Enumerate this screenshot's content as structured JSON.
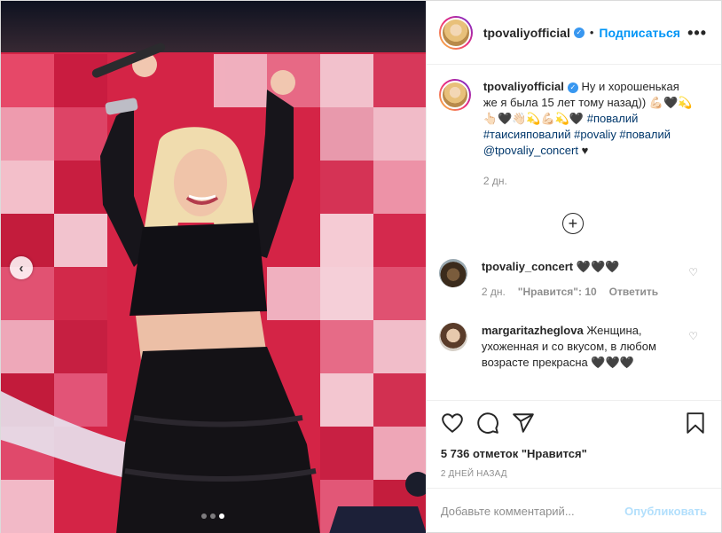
{
  "post": {
    "username": "tpovaliyofficial",
    "follow_separator": "•",
    "follow_label": "Подписаться",
    "more_label": "•••",
    "carousel": {
      "slides": 3,
      "active_slide": 3
    }
  },
  "caption": {
    "username": "tpovaliyofficial",
    "text": "Ну и хорошенькая же я была 15 лет тому назад)) 💪🏻🖤💫👆🏻🖤👋🏻💫💪🏻💫🖤",
    "hashtags": "#повалий #таисияповалий #povaliy #повалий",
    "mention": "@tpovaliy_concert",
    "tail": "♥",
    "time": "2 дн."
  },
  "comments": [
    {
      "username": "tpovaliy_concert",
      "text": "🖤🖤🖤",
      "time": "2 дн.",
      "likes": "\"Нравится\": 10",
      "reply": "Ответить"
    },
    {
      "username": "margaritazheglova",
      "text": "Женщина, ухоженная и со вкусом, в любом возрасте прекрасна 🖤🖤🖤"
    }
  ],
  "stats": {
    "likes": "5 736 отметок \"Нравится\"",
    "date": "2 ДНЕЙ НАЗАД"
  },
  "add_comment": {
    "placeholder": "Добавьте комментарий...",
    "publish": "Опубликовать"
  },
  "colors": {
    "accent": "#0095f6",
    "publish_disabled": "#b2dffc",
    "screen_red": "#d9264a"
  },
  "icons": [
    "heart-icon",
    "comment-icon",
    "share-icon",
    "bookmark-icon",
    "plus-circle-icon",
    "verified-icon",
    "chevron-left-icon"
  ]
}
